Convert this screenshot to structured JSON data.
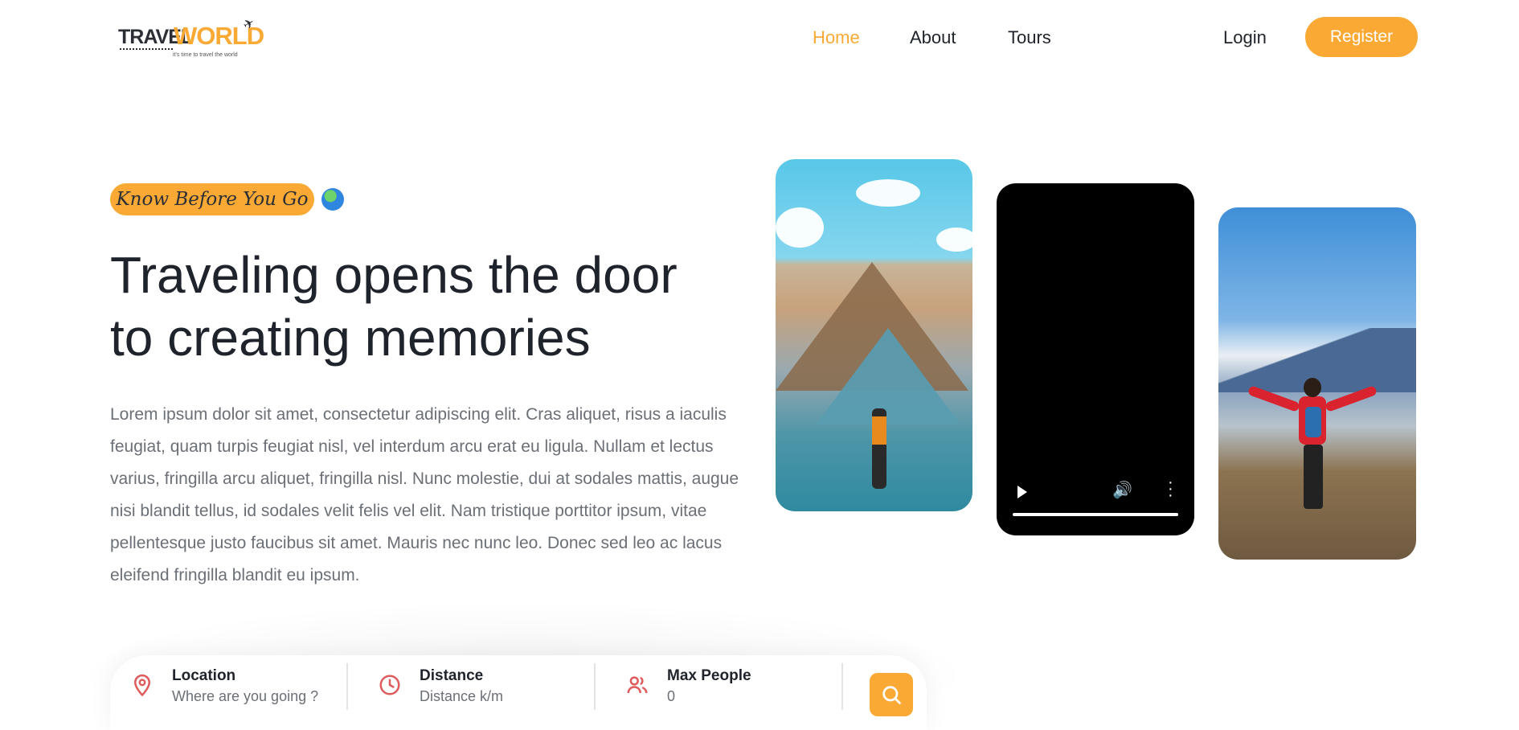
{
  "brand": {
    "logo_left": "TRAVEL",
    "logo_right": "WORLD",
    "tagline": "it's time to travel the world"
  },
  "nav": {
    "home": "Home",
    "about": "About",
    "tours": "Tours",
    "login": "Login",
    "register": "Register",
    "active": "Home"
  },
  "hero": {
    "subtitle": "Know Before You Go",
    "title_line1": "Traveling opens the door",
    "title_line2": "to creating memories",
    "paragraph": "Lorem ipsum dolor sit amet, consectetur adipiscing elit. Cras aliquet, risus a iaculis feugiat, quam turpis feugiat nisl, vel interdum arcu erat eu ligula. Nullam et lectus varius, fringilla arcu aliquet, fringilla nisl. Nunc molestie, dui at sodales mattis, augue nisi blandit tellus, id sodales velit felis vel elit. Nam tristique porttitor ipsum, vitae pellentesque justo faucibus sit amet. Mauris nec nunc leo. Donec sed leo ac lacus eleifend fringilla blandit eu ipsum."
  },
  "search": {
    "location_label": "Location",
    "location_placeholder": "Where are you going ?",
    "distance_label": "Distance",
    "distance_placeholder": "Distance k/m",
    "people_label": "Max People",
    "people_placeholder": "0"
  },
  "icons": {
    "location": "map-pin-icon",
    "distance": "clock-icon",
    "people": "users-icon",
    "search": "search-icon",
    "globe": "globe-icon",
    "video_play": "play-icon",
    "video_volume": "volume-icon",
    "video_more": "more-vertical-icon"
  },
  "colors": {
    "accent": "#faa935",
    "icon_red": "#e05b5b",
    "heading": "#1f232b",
    "text_muted": "#6b6f76"
  }
}
